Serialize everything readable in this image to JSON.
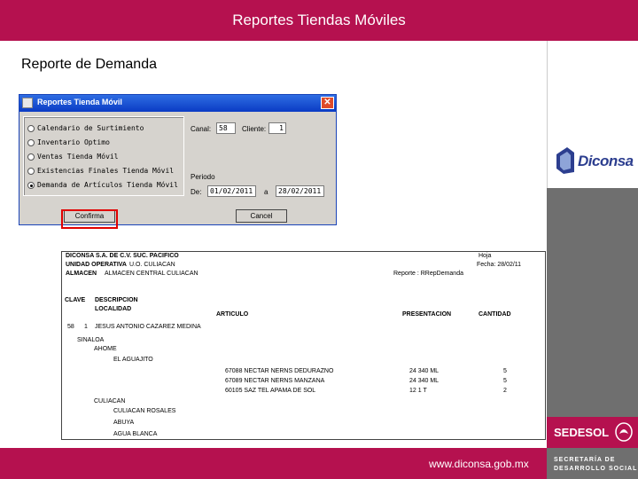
{
  "slide": {
    "title": "Reportes Tiendas Móviles",
    "subtitle": "Reporte de Demanda",
    "footer_url": "www.diconsa.gob.mx"
  },
  "branding": {
    "diconsa": "Diconsa",
    "sedesol": "SEDESOL",
    "secretaria_line1": "SECRETARÍA DE",
    "secretaria_line2": "DESARROLLO SOCIAL"
  },
  "dialog": {
    "title": "Reportes Tienda Móvil",
    "options": [
      {
        "label": "Calendario de Surtimiento",
        "selected": false
      },
      {
        "label": "Inventario Optimo",
        "selected": false
      },
      {
        "label": "Ventas Tienda Móvil",
        "selected": false
      },
      {
        "label": "Existencias Finales Tienda Móvil",
        "selected": false
      },
      {
        "label": "Demanda de Artículos Tienda Móvil",
        "selected": true
      }
    ],
    "canal_label": "Canal:",
    "canal_value": "58",
    "cliente_label": "Cliente:",
    "cliente_value": "1",
    "periodo_label": "Periodo",
    "de_label": "De:",
    "de_value": "01/02/2011",
    "a_label": "a",
    "a_value": "28/02/2011",
    "confirma_button": "Confirma",
    "cancel_button": "Cancel"
  },
  "report": {
    "header": {
      "line1": "DICONSA S.A. DE C.V.  SUC. PACIFICO",
      "line2_label": "UNIDAD OPERATIVA",
      "line2_value": "U.O. CULIACAN",
      "line3_label": "ALMACEN",
      "line3_value": "ALMACEN CENTRAL CULIACAN",
      "hoja": "Hoja",
      "fecha": "Fecha: 28/02/11",
      "reporte": "Reporte : RRepDemanda"
    },
    "columns": {
      "clave": "CLAVE",
      "descripcion": "DESCRIPCION",
      "localidad": "LOCALIDAD",
      "articulo": "ARTICULO",
      "presentacion": "PRESENTACION",
      "cantidad": "CANTIDAD"
    },
    "client": {
      "clave": "58",
      "num": "1",
      "name": "JESUS ANTONIO CAZAREZ MEDINA"
    },
    "state": "SINALOA",
    "municipio1": "AHOME",
    "localidad1": "EL AGUAJITO",
    "items": [
      {
        "articulo": "67088 NECTAR NERNS DEDURAZNO",
        "presentacion": "24  340  ML",
        "cantidad": "5"
      },
      {
        "articulo": "67089 NECTAR NERNS MANZANA",
        "presentacion": "24  340  ML",
        "cantidad": "5"
      },
      {
        "articulo": "60105 SAZ TEL APAMA DE SOL",
        "presentacion": "12   1   T",
        "cantidad": "2"
      }
    ],
    "municipio2": "CULIACAN",
    "localidades2": [
      "CULIACAN ROSALES",
      "ABUYA",
      "AGUA BLANCA"
    ]
  }
}
